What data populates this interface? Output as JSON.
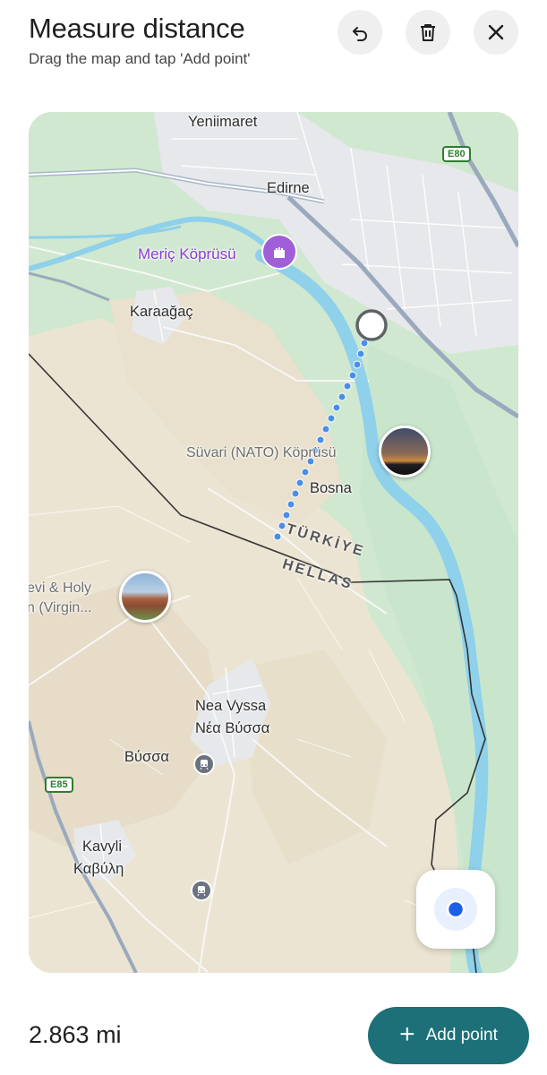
{
  "header": {
    "title": "Measure distance",
    "subtitle": "Drag the map and tap 'Add point'"
  },
  "toolbar": {
    "undo_icon": "undo-icon",
    "delete_icon": "trash-icon",
    "close_icon": "close-icon"
  },
  "map": {
    "places": {
      "yeniimaret": "Yeniimaret",
      "edirne": "Edirne",
      "meric": "Meriç Köprüsü",
      "karaagac": "Karaağaç",
      "suvari": "Süvari (NATO) Köprüsü",
      "bosna": "Bosna",
      "holy_line1": "evi & Holy",
      "holy_line2": "n (Virgin...",
      "nea_vyssa": "Nea Vyssa",
      "nea_vyssa_gr": "Νέα Βύσσα",
      "vyssa": "Βύσσα",
      "kavyli": "Kavyli",
      "kavyli_gr": "Καβύλη"
    },
    "countries": {
      "turkey": "TÜRKİYE",
      "greece": "HELLAS"
    },
    "roads": {
      "e80": "E80",
      "e85": "E85"
    },
    "colors": {
      "river": "#8fd0ea",
      "forest": "#c9e6cc",
      "farmland": "#ede4d3",
      "urban": "#e7e9ec",
      "route": "#4a8fe7",
      "border": "#333333",
      "poi": "#a05ed8"
    }
  },
  "footer": {
    "distance": "2.863 mi",
    "add_point_label": "Add point"
  }
}
